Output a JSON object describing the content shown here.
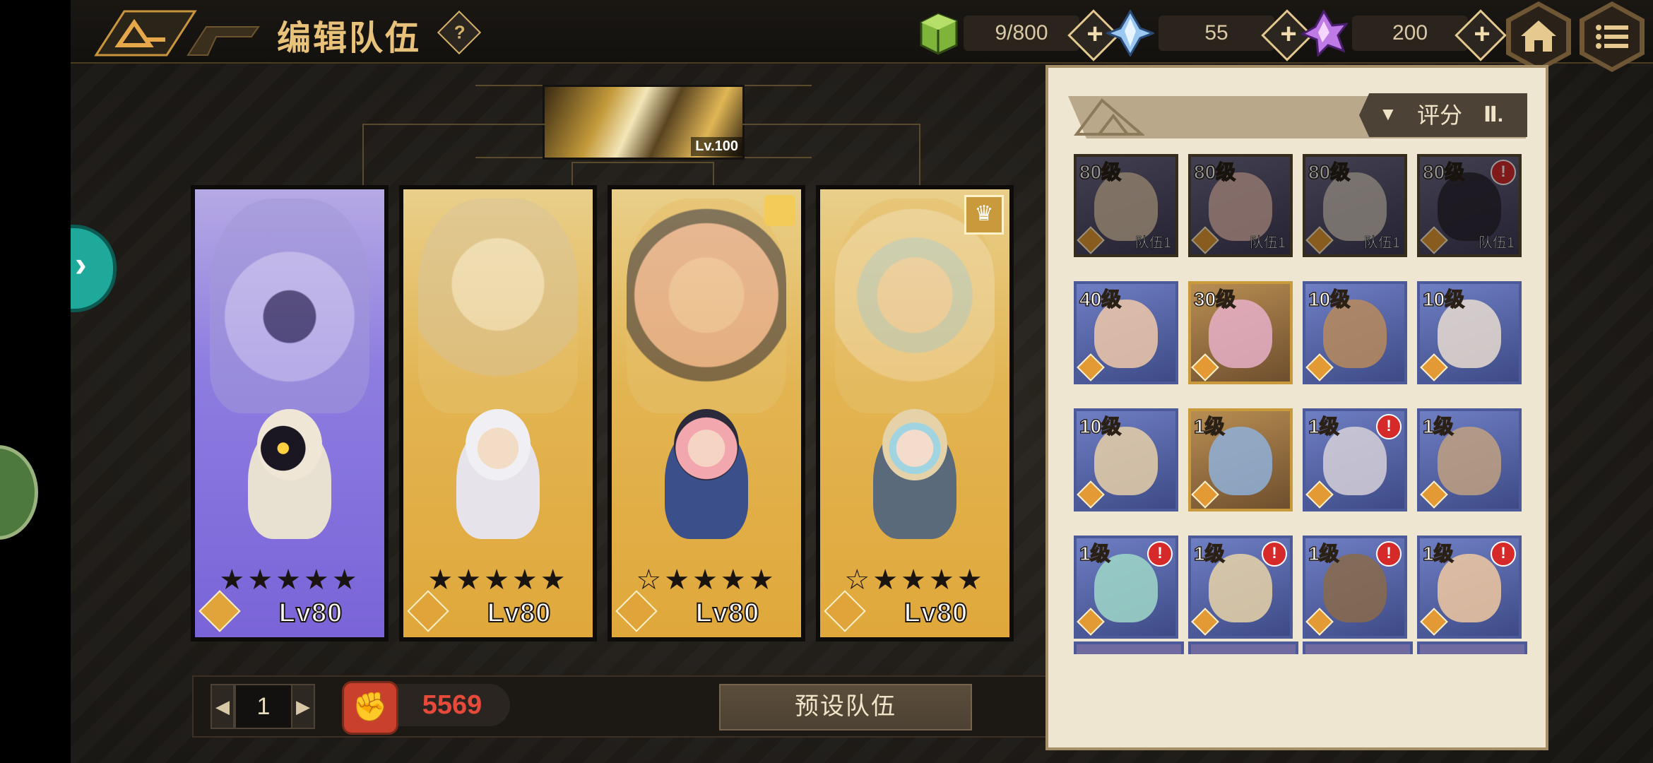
{
  "header": {
    "title": "编辑队伍",
    "help_label": "?",
    "stamina": "9/800",
    "blue_gem": "55",
    "purple_gem": "200",
    "plus_label": "+",
    "home_icon": "home-icon",
    "menu_icon": "menu-icon"
  },
  "leader": {
    "level": "Lv.100"
  },
  "team": [
    {
      "slot": 1,
      "theme": "purple",
      "stars": "★★★★★",
      "level": "Lv80",
      "element_icon": "shield-gem-icon"
    },
    {
      "slot": 2,
      "theme": "gold",
      "stars": "★★★★★",
      "level": "Lv80",
      "element_icon": "arrow-up-gem-icon"
    },
    {
      "slot": 3,
      "theme": "gold",
      "stars": "☆★★★★",
      "level": "Lv80",
      "element_icon": "cross-gem-icon"
    },
    {
      "slot": 4,
      "theme": "gold",
      "stars": "☆★★★★",
      "level": "Lv80",
      "element_icon": "shield-gem-icon",
      "crown": "♛"
    }
  ],
  "footer": {
    "page": "1",
    "prev": "◀",
    "next": "▶",
    "power_icon": "✊",
    "power": "5569",
    "preset_button": "预设队伍"
  },
  "roster": {
    "sort_icon": "▼",
    "sort_label": "评分",
    "sort_bars": "Ⅱ.",
    "tiles": [
      {
        "level": "80级",
        "team": "队伍1",
        "alert": false,
        "style": "dim"
      },
      {
        "level": "80级",
        "team": "队伍1",
        "alert": false,
        "style": "dim"
      },
      {
        "level": "80级",
        "team": "队伍1",
        "alert": false,
        "style": "dim"
      },
      {
        "level": "80级",
        "team": "队伍1",
        "alert": true,
        "style": "dim"
      },
      {
        "level": "40级",
        "team": "",
        "alert": false,
        "style": "blue"
      },
      {
        "level": "30级",
        "team": "",
        "alert": false,
        "style": "gold"
      },
      {
        "level": "10级",
        "team": "",
        "alert": false,
        "style": "blue"
      },
      {
        "level": "10级",
        "team": "",
        "alert": false,
        "style": "blue"
      },
      {
        "level": "10级",
        "team": "",
        "alert": false,
        "style": "blue"
      },
      {
        "level": "1级",
        "team": "",
        "alert": false,
        "style": "gold"
      },
      {
        "level": "1级",
        "team": "",
        "alert": true,
        "style": "blue"
      },
      {
        "level": "1级",
        "team": "",
        "alert": false,
        "style": "blue"
      },
      {
        "level": "1级",
        "team": "",
        "alert": true,
        "style": "blue"
      },
      {
        "level": "1级",
        "team": "",
        "alert": true,
        "style": "blue"
      },
      {
        "level": "1级",
        "team": "",
        "alert": true,
        "style": "blue"
      },
      {
        "level": "1级",
        "team": "",
        "alert": true,
        "style": "blue"
      }
    ],
    "alert_mark": "!"
  }
}
